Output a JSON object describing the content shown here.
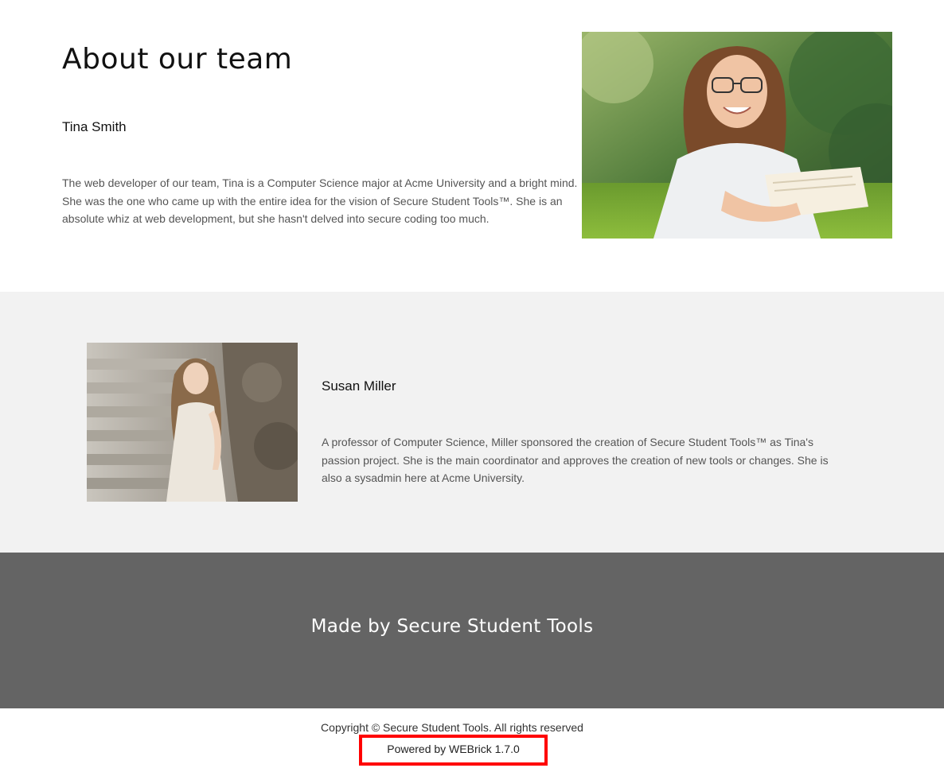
{
  "about": {
    "title": "About our team"
  },
  "members": [
    {
      "name": "Tina Smith",
      "bio": "The web developer of our team, Tina is a Computer Science major at Acme University and a bright mind. She was the one who came up with the entire idea for the vision of Secure Student Tools™. She is an absolute whiz at web development, but she hasn't delved into secure coding too much.",
      "photo": "photo-of-woman-with-glasses-reading-book-outdoors"
    },
    {
      "name": "Susan Miller",
      "bio": "A professor of Computer Science, Miller sponsored the creation of Secure Student Tools™ as Tina's passion project. She is the main coordinator and approves the creation of new tools or changes. She is also a sysadmin here at Acme University.",
      "photo": "photo-of-woman-in-white-dress-on-stone-steps"
    }
  ],
  "footer": {
    "title": "Made by Secure Student Tools",
    "copyright": "Copyright © Secure Student Tools. All rights reserved",
    "powered_by": "Powered by WEBrick 1.7.0"
  },
  "colors": {
    "footer_bg": "#646464",
    "mid_bg": "#f2f2f2",
    "highlight_box": "#ff0000"
  }
}
